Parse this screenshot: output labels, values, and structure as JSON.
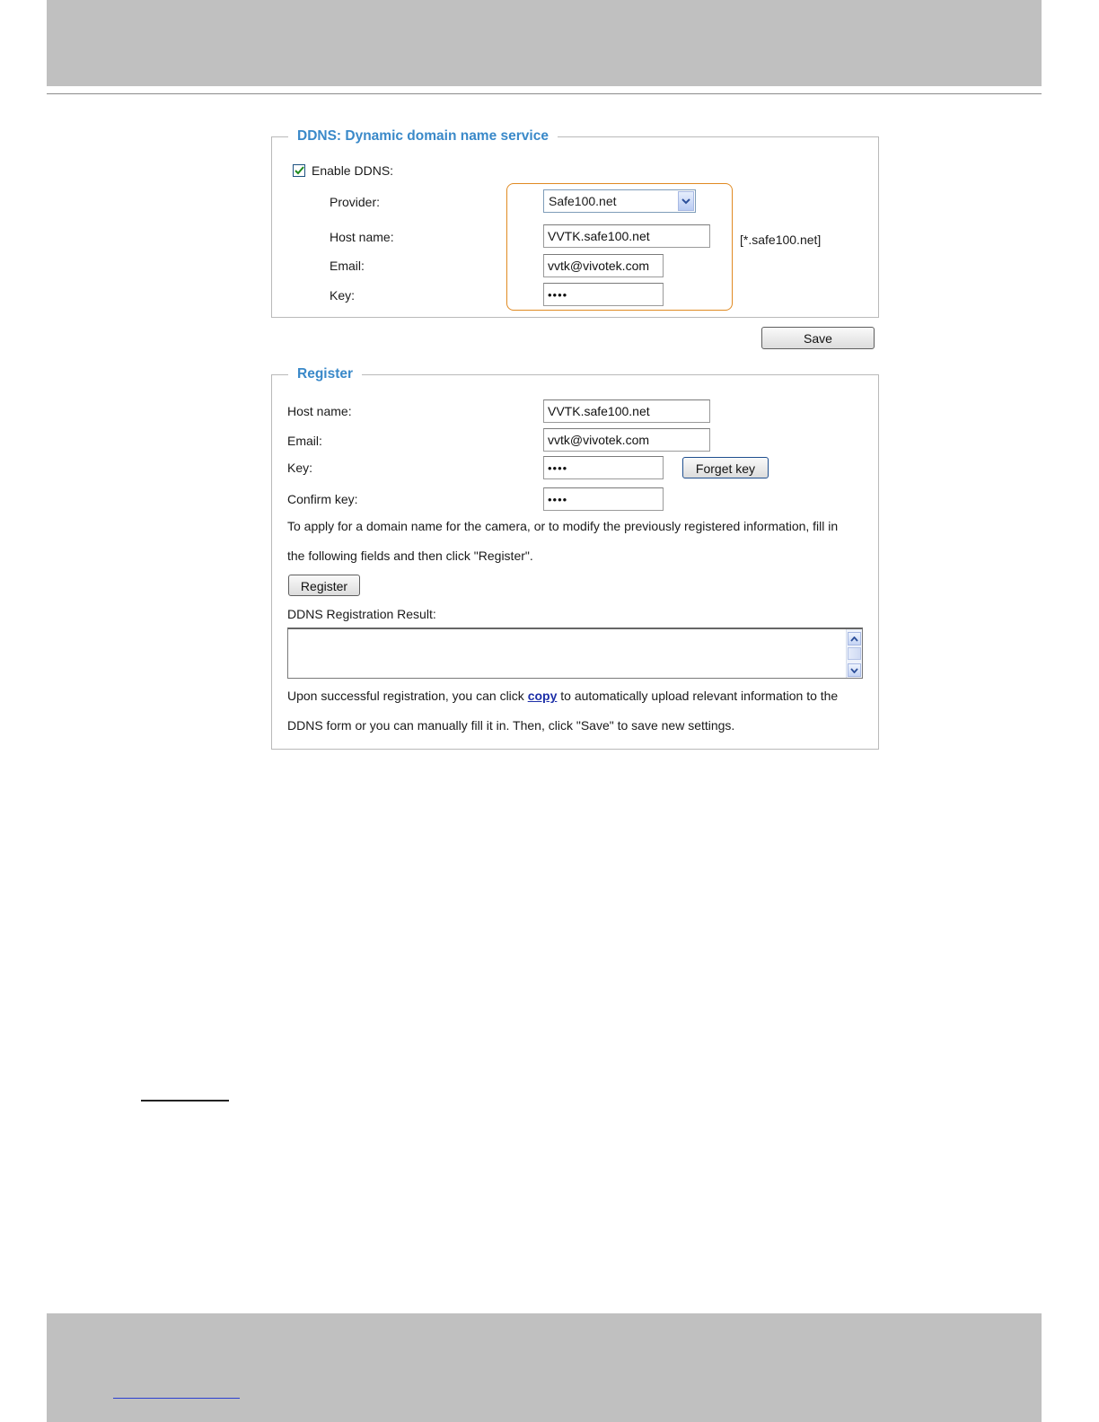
{
  "ddns": {
    "title": "DDNS: Dynamic domain name service",
    "enable_label": "Enable DDNS:",
    "enable_checked": true,
    "provider_label": "Provider:",
    "provider_value": "Safe100.net",
    "host_label": "Host name:",
    "host_value": "VVTK.safe100.net",
    "host_suffix": "[*.safe100.net]",
    "email_label": "Email:",
    "email_value": "vvtk@vivotek.com",
    "key_label": "Key:",
    "key_value": "••••",
    "highlight_color": "#e08a22"
  },
  "save_button": "Save",
  "register": {
    "title": "Register",
    "host_label": "Host name:",
    "host_value": "VVTK.safe100.net",
    "email_label": "Email:",
    "email_value": "vvtk@vivotek.com",
    "key_label": "Key:",
    "key_value": "••••",
    "forget_key_button": "Forget key",
    "confirm_key_label": "Confirm key:",
    "confirm_key_value": "••••",
    "instructions_line1": "To apply for a domain name for the camera, or to modify the previously registered information, fill in",
    "instructions_line2": "the following fields and then click \"Register\".",
    "register_button": "Register",
    "result_label": "DDNS Registration Result:",
    "result_text": "",
    "note_before_link": "Upon successful registration, you can click ",
    "note_link": "copy",
    "note_after_link": " to automatically upload relevant information to the",
    "note_line2": "DDNS form or you can manually fill it in. Then, click \"Save\" to save new settings."
  },
  "colors": {
    "legend": "#3a89c9",
    "band": "#c0c0c0",
    "link": "#1d2fa8"
  }
}
